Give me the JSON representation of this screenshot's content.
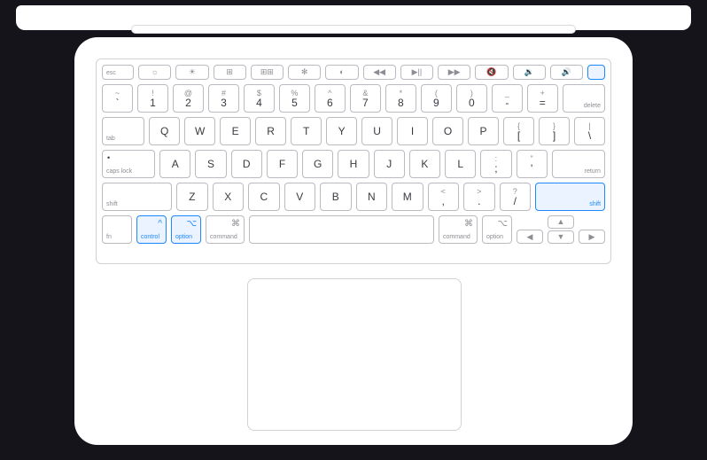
{
  "fnrow": [
    "esc",
    "☼",
    "☀",
    "⊞",
    "⊞⊞",
    "✻",
    "◐",
    "◀◀",
    "▶||",
    "▶▶",
    "🔇",
    "🔉",
    "🔊",
    ""
  ],
  "numTop": [
    "~",
    "!",
    "@",
    "#",
    "$",
    "%",
    "^",
    "&",
    "*",
    "(",
    ")",
    "_",
    "+"
  ],
  "numMain": [
    "`",
    "1",
    "2",
    "3",
    "4",
    "5",
    "6",
    "7",
    "8",
    "9",
    "0",
    "-",
    "="
  ],
  "delete": "delete",
  "tab": "tab",
  "qwerty": [
    "Q",
    "W",
    "E",
    "R",
    "T",
    "Y",
    "U",
    "I",
    "O",
    "P"
  ],
  "brL": {
    "t": "{",
    "b": "["
  },
  "brR": {
    "t": "}",
    "b": "]"
  },
  "pipe": {
    "t": "|",
    "b": "\\"
  },
  "caps": {
    "dot": "•",
    "label": "caps lock"
  },
  "asdf": [
    "A",
    "S",
    "D",
    "F",
    "G",
    "H",
    "J",
    "K",
    "L"
  ],
  "semi": {
    "t": ":",
    "b": ";"
  },
  "quote": {
    "t": "\"",
    "b": "'"
  },
  "return": "return",
  "shiftL": "shift",
  "zxc": [
    "Z",
    "X",
    "C",
    "V",
    "B",
    "N",
    "M"
  ],
  "comma": {
    "t": "<",
    "b": ","
  },
  "period": {
    "t": ">",
    "b": "."
  },
  "slash": {
    "t": "?",
    "b": "/"
  },
  "shiftR": "shift",
  "bottom": {
    "fn": "fn",
    "control": "control",
    "optionL": "option",
    "commandL": "command",
    "commandR": "command",
    "optionR": "option",
    "ctrlSym": "^",
    "optSym": "⌥",
    "cmdSym": "⌘"
  },
  "arrows": {
    "l": "◀",
    "r": "▶",
    "u": "▲",
    "d": "▼"
  }
}
